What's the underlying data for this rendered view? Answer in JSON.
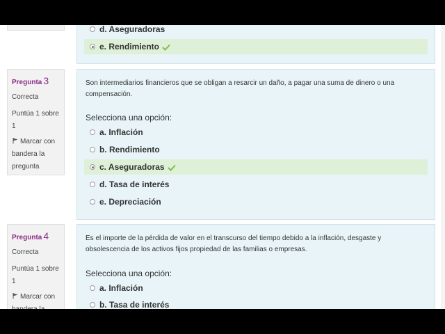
{
  "prev_question": {
    "options": [
      {
        "label": "d. Aseguradoras",
        "selected": false,
        "correct": false
      },
      {
        "label": "e. Rendimiento",
        "selected": true,
        "correct": true
      }
    ]
  },
  "questions": [
    {
      "label": "Pregunta",
      "number": "3",
      "state": "Correcta",
      "grade": "Puntúa 1 sobre 1",
      "flag_label": "Marcar con bandera la pregunta",
      "text": "Son intermediarios financieros que se obligan a resarcir un daño, a pagar una suma de dinero o una compensación.",
      "prompt": "Selecciona una opción:",
      "options": [
        {
          "label": "a. Inflación",
          "selected": false,
          "correct": false
        },
        {
          "label": "b. Rendimiento",
          "selected": false,
          "correct": false
        },
        {
          "label": "c. Aseguradoras",
          "selected": true,
          "correct": true
        },
        {
          "label": "d. Tasa de interés",
          "selected": false,
          "correct": false
        },
        {
          "label": "e. Depreciación",
          "selected": false,
          "correct": false
        }
      ]
    },
    {
      "label": "Pregunta",
      "number": "4",
      "state": "Correcta",
      "grade": "Puntúa 1 sobre 1",
      "flag_label": "Marcar con bandera la pregunta",
      "text": "Es el importe de la pérdida de valor en el transcurso del tiempo debido a la inflación, desgaste y obsolescencia de los activos fijos propiedad de las familias o empresas.",
      "prompt": "Selecciona una opción:",
      "options": [
        {
          "label": "a. Inflación",
          "selected": false,
          "correct": false
        },
        {
          "label": "b. Tasa de interés",
          "selected": false,
          "correct": false
        }
      ]
    }
  ],
  "colors": {
    "accent": "#8c2b87",
    "panel": "#e8f4f8",
    "correct_bg": "#dff0d8",
    "check": "#7bbf4a"
  }
}
